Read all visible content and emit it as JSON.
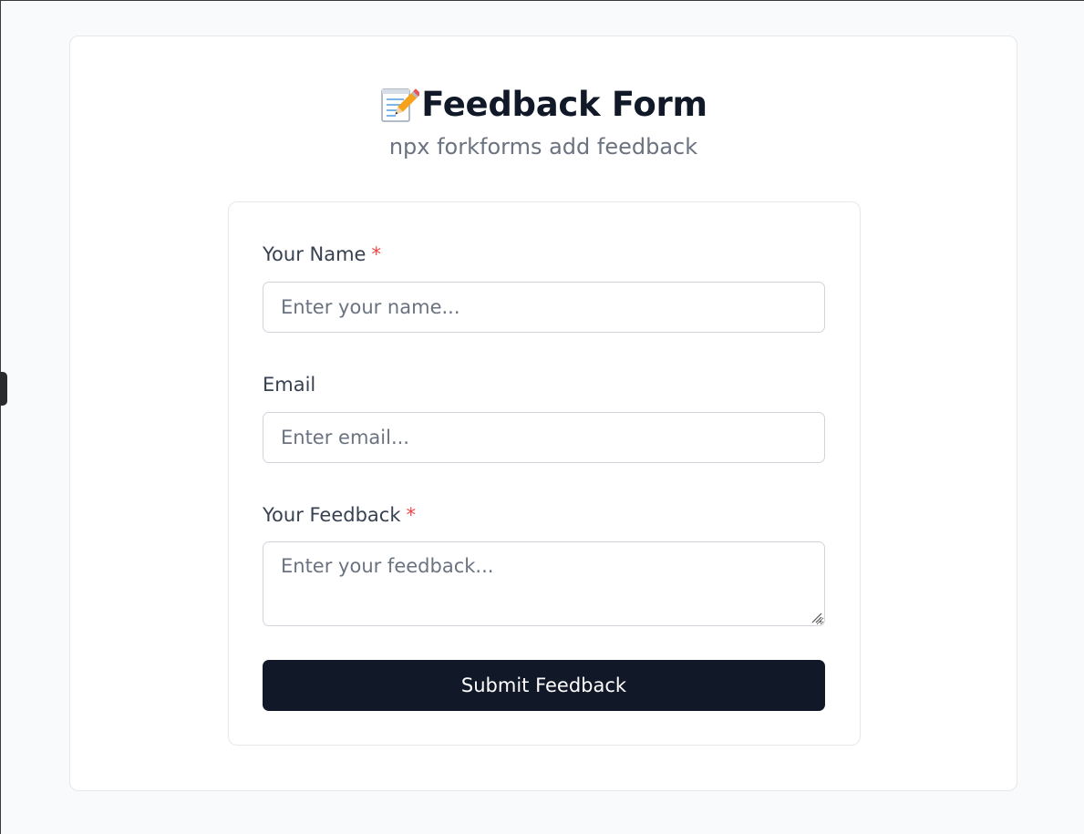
{
  "header": {
    "icon": "memo-pencil-icon",
    "title": "Feedback Form",
    "subtitle": "npx forkforms add feedback"
  },
  "form": {
    "fields": [
      {
        "label": "Your Name",
        "required_marker": "*",
        "placeholder": "Enter your name...",
        "value": ""
      },
      {
        "label": "Email",
        "placeholder": "Enter email...",
        "value": ""
      },
      {
        "label": "Your Feedback",
        "required_marker": "*",
        "placeholder": "Enter your feedback...",
        "value": ""
      }
    ],
    "submit_label": "Submit Feedback"
  },
  "colors": {
    "accent": "#111827",
    "required": "#ef4444",
    "muted_text": "#6b7280",
    "page_background": "#f9fafb"
  }
}
